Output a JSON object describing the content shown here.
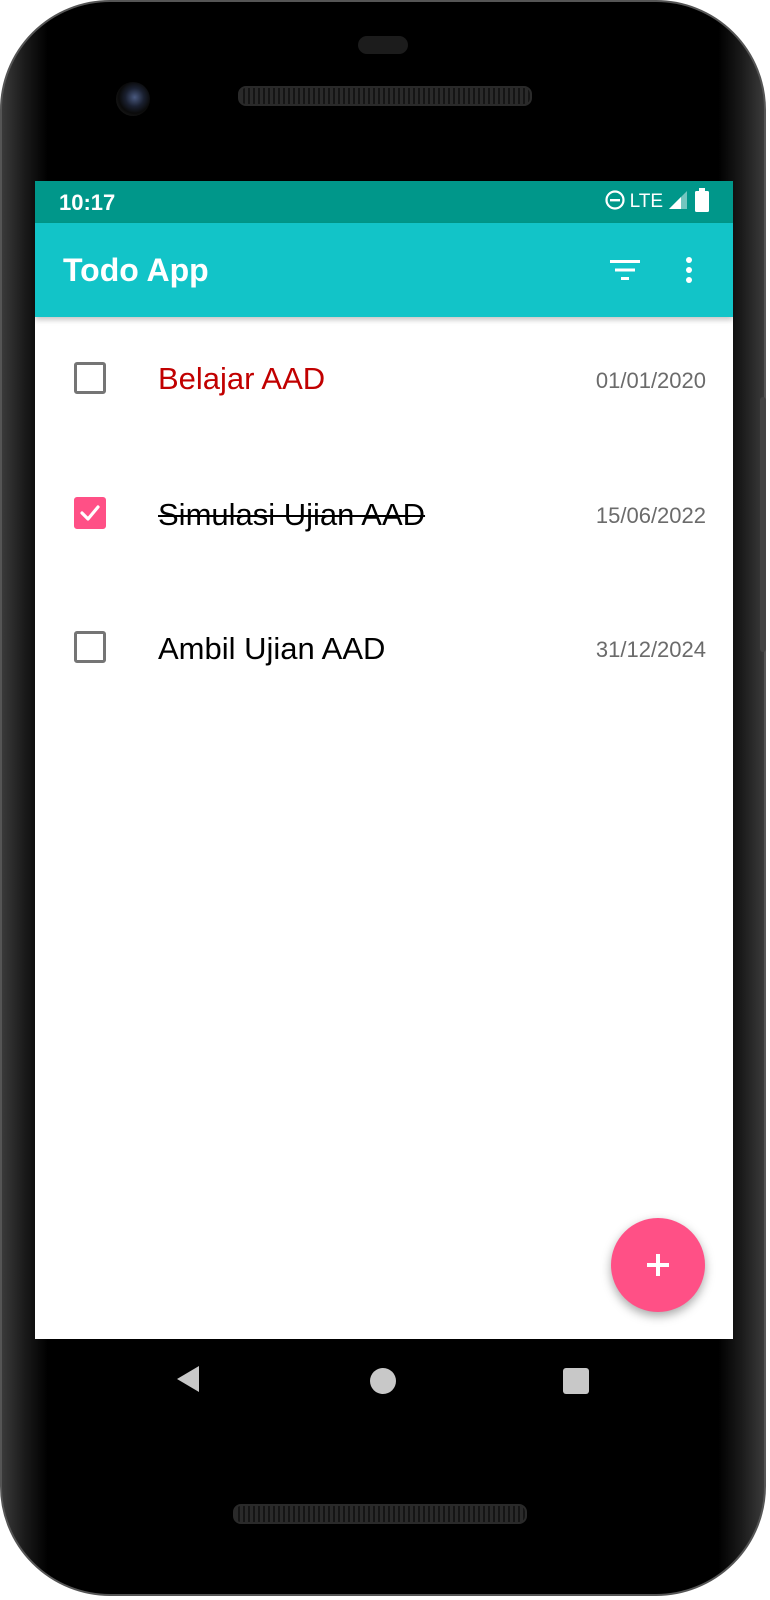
{
  "status_bar": {
    "time": "10:17",
    "network": "LTE",
    "icons": [
      "do-not-disturb-icon",
      "signal-icon",
      "battery-icon"
    ]
  },
  "app_bar": {
    "title": "Todo App",
    "actions": [
      "filter-icon",
      "more-vert-icon"
    ]
  },
  "todos": [
    {
      "title": "Belajar AAD",
      "date": "01/01/2020",
      "completed": false,
      "overdue": true
    },
    {
      "title": "Simulasi Ujian AAD",
      "date": "15/06/2022",
      "completed": true,
      "overdue": false
    },
    {
      "title": "Ambil Ujian AAD",
      "date": "31/12/2024",
      "completed": false,
      "overdue": false
    }
  ],
  "fab": {
    "icon": "add-icon"
  },
  "nav_bar": {
    "buttons": [
      "back-icon",
      "home-icon",
      "recents-icon"
    ]
  },
  "colors": {
    "status_bar": "#00978a",
    "app_bar": "#12c4c8",
    "accent": "#ff5086",
    "overdue_text": "#c10000",
    "date_text": "#6b6b6b"
  }
}
